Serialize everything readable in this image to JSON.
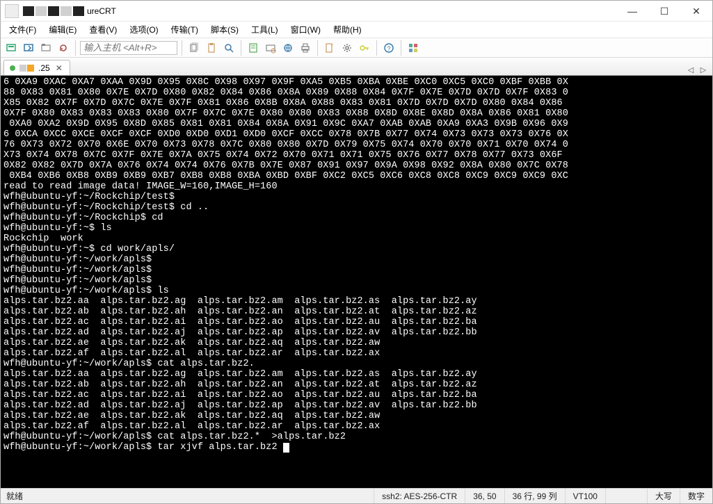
{
  "title_suffix": "ureCRT",
  "menu": {
    "file": "文件(F)",
    "edit": "编辑(E)",
    "view": "查看(V)",
    "options": "选项(O)",
    "transfer": "传输(T)",
    "script": "脚本(S)",
    "tools": "工具(L)",
    "window": "窗口(W)",
    "help": "帮助(H)"
  },
  "host_placeholder": "输入主机 <Alt+R>",
  "tab_suffix": ".25",
  "terminal_lines": [
    "6 0XA9 0XAC 0XA7 0XAA 0X9D 0X95 0X8C 0X98 0X97 0X9F 0XA5 0XB5 0XBA 0XBE 0XC0 0XC5 0XC0 0XBF 0XBB 0X",
    "88 0X83 0X81 0X80 0X7E 0X7D 0X80 0X82 0X84 0X86 0X8A 0X89 0X88 0X84 0X7F 0X7E 0X7D 0X7D 0X7F 0X83 0",
    "X85 0X82 0X7F 0X7D 0X7C 0X7E 0X7F 0X81 0X86 0X8B 0X8A 0X88 0X83 0X81 0X7D 0X7D 0X7D 0X80 0X84 0X86 ",
    "0X7F 0X80 0X83 0X83 0X83 0X80 0X7F 0X7C 0X7E 0X80 0X80 0X83 0X88 0X8D 0X8E 0X8D 0X8A 0X86 0X81 0X80",
    " 0XA0 0XA2 0X9D 0X95 0X8D 0X85 0X81 0X81 0X84 0X8A 0X91 0X9C 0XA7 0XAB 0XAB 0XA9 0XA3 0X9B 0X96 0X9",
    "6 0XCA 0XCC 0XCE 0XCF 0XCF 0XD0 0XD0 0XD1 0XD0 0XCF 0XCC 0X78 0X7B 0X77 0X74 0X73 0X73 0X73 0X76 0X",
    "76 0X73 0X72 0X70 0X6E 0X70 0X73 0X78 0X7C 0X80 0X80 0X7D 0X79 0X75 0X74 0X70 0X70 0X71 0X70 0X74 0",
    "X73 0X74 0X78 0X7C 0X7F 0X7E 0X7A 0X75 0X74 0X72 0X70 0X71 0X71 0X75 0X76 0X77 0X78 0X77 0X73 0X6F ",
    "0X82 0X82 0X7D 0X7A 0X76 0X74 0X74 0X76 0X7B 0X7E 0X87 0X91 0X97 0X9A 0X98 0X92 0X8A 0X80 0X7C 0X78",
    " 0XB4 0XB6 0XB8 0XB9 0XB9 0XB7 0XB8 0XB8 0XBA 0XBD 0XBF 0XC2 0XC5 0XC6 0XC8 0XC8 0XC9 0XC9 0XC9 0XC",
    "read to read image data! IMAGE_W=160,IMAGE_H=160",
    "wfh@ubuntu-yf:~/Rockchip/test$",
    "wfh@ubuntu-yf:~/Rockchip/test$ cd ..",
    "wfh@ubuntu-yf:~/Rockchip$ cd",
    "wfh@ubuntu-yf:~$ ls",
    "Rockchip  work",
    "wfh@ubuntu-yf:~$ cd work/apls/",
    "wfh@ubuntu-yf:~/work/apls$",
    "wfh@ubuntu-yf:~/work/apls$",
    "wfh@ubuntu-yf:~/work/apls$",
    "wfh@ubuntu-yf:~/work/apls$ ls",
    "alps.tar.bz2.aa  alps.tar.bz2.ag  alps.tar.bz2.am  alps.tar.bz2.as  alps.tar.bz2.ay",
    "alps.tar.bz2.ab  alps.tar.bz2.ah  alps.tar.bz2.an  alps.tar.bz2.at  alps.tar.bz2.az",
    "alps.tar.bz2.ac  alps.tar.bz2.ai  alps.tar.bz2.ao  alps.tar.bz2.au  alps.tar.bz2.ba",
    "alps.tar.bz2.ad  alps.tar.bz2.aj  alps.tar.bz2.ap  alps.tar.bz2.av  alps.tar.bz2.bb",
    "alps.tar.bz2.ae  alps.tar.bz2.ak  alps.tar.bz2.aq  alps.tar.bz2.aw",
    "alps.tar.bz2.af  alps.tar.bz2.al  alps.tar.bz2.ar  alps.tar.bz2.ax",
    "wfh@ubuntu-yf:~/work/apls$ cat alps.tar.bz2.",
    "alps.tar.bz2.aa  alps.tar.bz2.ag  alps.tar.bz2.am  alps.tar.bz2.as  alps.tar.bz2.ay",
    "alps.tar.bz2.ab  alps.tar.bz2.ah  alps.tar.bz2.an  alps.tar.bz2.at  alps.tar.bz2.az",
    "alps.tar.bz2.ac  alps.tar.bz2.ai  alps.tar.bz2.ao  alps.tar.bz2.au  alps.tar.bz2.ba",
    "alps.tar.bz2.ad  alps.tar.bz2.aj  alps.tar.bz2.ap  alps.tar.bz2.av  alps.tar.bz2.bb",
    "alps.tar.bz2.ae  alps.tar.bz2.ak  alps.tar.bz2.aq  alps.tar.bz2.aw",
    "alps.tar.bz2.af  alps.tar.bz2.al  alps.tar.bz2.ar  alps.tar.bz2.ax",
    "wfh@ubuntu-yf:~/work/apls$ cat alps.tar.bz2.*  >alps.tar.bz2",
    "wfh@ubuntu-yf:~/work/apls$ tar xjvf alps.tar.bz2 "
  ],
  "status": {
    "ready": "就绪",
    "cipher": "ssh2: AES-256-CTR",
    "cursor": "36, 50",
    "size": "36 行, 99 列",
    "term": "VT100",
    "caps": "大写",
    "num": "数字"
  }
}
